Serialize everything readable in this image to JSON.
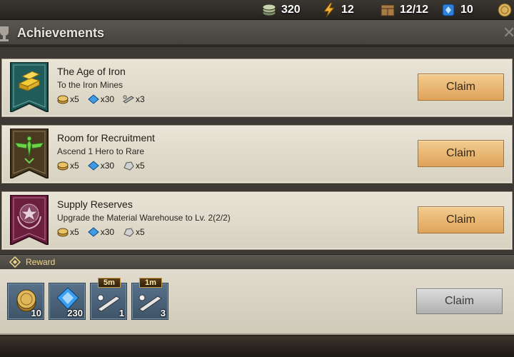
{
  "topbar": {
    "resources": [
      {
        "name": "coins-stack",
        "value": "320"
      },
      {
        "name": "energy",
        "value": "12"
      },
      {
        "name": "crates",
        "value": "12/12"
      },
      {
        "name": "gems",
        "value": "10"
      },
      {
        "name": "gold-coin",
        "value": ""
      }
    ]
  },
  "header": {
    "title": "Achievements",
    "title_icon": "trophy-icon",
    "close_icon": "close-icon"
  },
  "achievements": [
    {
      "title": "The Age of Iron",
      "description": "To the Iron Mines",
      "banner_icon": "gold-bars-icon",
      "banner_color": "#1f5c5a",
      "rewards": [
        {
          "icon": "coin-icon",
          "amount": "x5"
        },
        {
          "icon": "gem-icon",
          "amount": "x30"
        },
        {
          "icon": "speedup-icon",
          "amount": "x3"
        }
      ],
      "button_label": "Claim"
    },
    {
      "title": "Room for Recruitment",
      "description": "Ascend 1 Hero to Rare",
      "banner_icon": "eagle-icon",
      "banner_color": "#4a3a22",
      "rewards": [
        {
          "icon": "coin-icon",
          "amount": "x5"
        },
        {
          "icon": "gem-icon",
          "amount": "x30"
        },
        {
          "icon": "stone-icon",
          "amount": "x5"
        }
      ],
      "button_label": "Claim"
    },
    {
      "title": "Supply Reserves",
      "description": "Upgrade the Material Warehouse to Lv. 2(2/2)",
      "banner_icon": "star-laurel-icon",
      "banner_color": "#6b1f3d",
      "rewards": [
        {
          "icon": "coin-icon",
          "amount": "x5"
        },
        {
          "icon": "gem-icon",
          "amount": "x30"
        },
        {
          "icon": "stone-icon",
          "amount": "x5"
        }
      ],
      "button_label": "Claim"
    }
  ],
  "reward_section": {
    "label": "Reward",
    "items": [
      {
        "icon": "coin-icon",
        "quantity": "10",
        "tag": ""
      },
      {
        "icon": "gem-icon",
        "quantity": "230",
        "tag": ""
      },
      {
        "icon": "speedup-icon",
        "quantity": "1",
        "tag": "5m"
      },
      {
        "icon": "speedup-icon",
        "quantity": "3",
        "tag": "1m"
      }
    ],
    "button_label": "Claim"
  }
}
